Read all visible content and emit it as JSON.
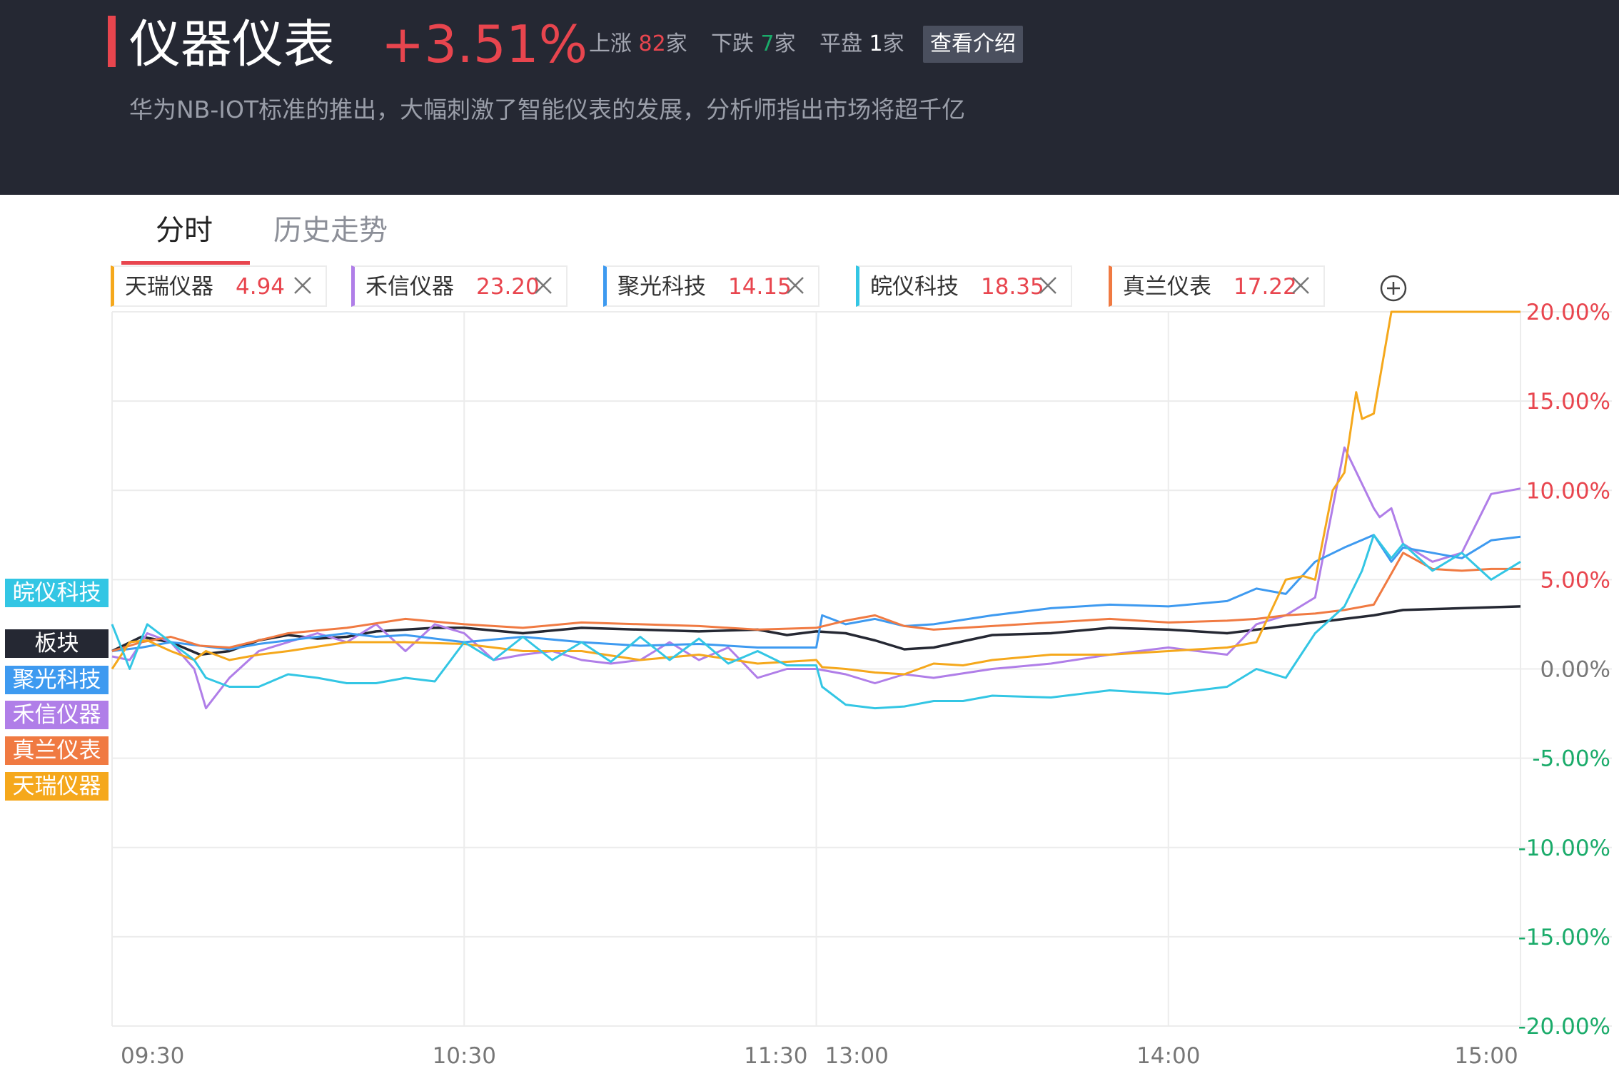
{
  "header": {
    "sector_name": "仪器仪表",
    "sector_change": "+3.51%",
    "up_label": "上涨",
    "up_count": "82",
    "down_label": "下跌",
    "down_count": "7",
    "flat_label": "平盘",
    "flat_count": "1",
    "unit": "家",
    "intro_button": "查看介绍",
    "subtitle": "华为NB-IOT标准的推出，大幅刺激了智能仪表的发展，分析师指出市场将超千亿"
  },
  "tabs": [
    {
      "label": "分时",
      "active": true
    },
    {
      "label": "历史走势",
      "active": false
    }
  ],
  "chips": [
    {
      "name": "天瑞仪器",
      "price": "4.94",
      "color": "#f5a81c"
    },
    {
      "name": "禾信仪器",
      "price": "23.20",
      "color": "#b07ee8"
    },
    {
      "name": "聚光科技",
      "price": "14.15",
      "color": "#3e9af0"
    },
    {
      "name": "皖仪科技",
      "price": "18.35",
      "color": "#33c6e4"
    },
    {
      "name": "真兰仪表",
      "price": "17.22",
      "color": "#f07a42"
    }
  ],
  "icons": {
    "close": "close-icon",
    "add": "plus-circle-icon"
  },
  "legend": [
    {
      "label": "皖仪科技",
      "color": "#33c6e4"
    },
    {
      "label": "板块",
      "color": "#252833"
    },
    {
      "label": "聚光科技",
      "color": "#3e9af0"
    },
    {
      "label": "禾信仪器",
      "color": "#b07ee8"
    },
    {
      "label": "真兰仪表",
      "color": "#f07a42"
    },
    {
      "label": "天瑞仪器",
      "color": "#f5a81c"
    }
  ],
  "colors": {
    "up": "#e8454e",
    "down": "#1aab6a",
    "header_bg": "#252833"
  },
  "chart_data": {
    "type": "line",
    "xlabel": "",
    "ylabel": "",
    "ylim": [
      -20,
      20
    ],
    "y_ticks": [
      20,
      15,
      10,
      5,
      0,
      -5,
      -10,
      -15,
      -20
    ],
    "y_tick_labels": [
      "20.00%",
      "15.00%",
      "10.00%",
      "5.00%",
      "0.00%",
      "-5.00%",
      "-10.00%",
      "-15.00%",
      "-20.00%"
    ],
    "x_ticks": [
      {
        "label": "09:30",
        "t": 0
      },
      {
        "label": "10:30",
        "t": 60
      },
      {
        "label": "11:30",
        "t": 120
      },
      {
        "label": "13:00",
        "t": 120
      },
      {
        "label": "14:00",
        "t": 180
      },
      {
        "label": "15:00",
        "t": 240
      }
    ],
    "grid": true,
    "legend_position": "left",
    "series": [
      {
        "name": "板块",
        "color": "#252833",
        "t": [
          0,
          5,
          10,
          15,
          20,
          25,
          30,
          35,
          40,
          45,
          50,
          55,
          60,
          70,
          80,
          90,
          100,
          110,
          115,
          120,
          125,
          130,
          135,
          140,
          150,
          160,
          170,
          180,
          190,
          200,
          210,
          215,
          220,
          230,
          240
        ],
        "values": [
          1,
          1.8,
          1.5,
          0.8,
          1,
          1.6,
          1.9,
          1.7,
          1.8,
          2.1,
          2.2,
          2.3,
          2.3,
          2,
          2.3,
          2.2,
          2.1,
          2.2,
          1.9,
          2.1,
          2,
          1.6,
          1.1,
          1.2,
          1.9,
          2,
          2.3,
          2.2,
          2,
          2.4,
          2.8,
          3,
          3.3,
          3.4,
          3.5
        ]
      },
      {
        "name": "禾信仪器",
        "color": "#b07ee8",
        "t": [
          0,
          3,
          6,
          10,
          14,
          16,
          20,
          25,
          30,
          35,
          40,
          45,
          50,
          55,
          60,
          65,
          70,
          75,
          80,
          85,
          90,
          95,
          100,
          105,
          110,
          115,
          120,
          125,
          130,
          135,
          140,
          150,
          160,
          170,
          180,
          190,
          195,
          200,
          205,
          210,
          215,
          216,
          218,
          220,
          225,
          230,
          235,
          240
        ],
        "values": [
          0.7,
          0.5,
          2,
          1.5,
          0,
          -2.2,
          -0.5,
          1,
          1.5,
          2,
          1.5,
          2.5,
          1,
          2.5,
          2,
          0.5,
          0.8,
          1,
          0.5,
          0.3,
          0.5,
          1.5,
          0.5,
          1.2,
          -0.5,
          0,
          0,
          -0.3,
          -0.8,
          -0.3,
          -0.5,
          0,
          0.3,
          0.8,
          1.2,
          0.8,
          2.5,
          3,
          4,
          12.4,
          9,
          8.5,
          9,
          7,
          6,
          6.5,
          9.8,
          10.1
        ]
      },
      {
        "name": "聚光科技",
        "color": "#3e9af0",
        "t": [
          0,
          5,
          10,
          15,
          20,
          25,
          30,
          35,
          40,
          45,
          50,
          60,
          70,
          80,
          90,
          100,
          110,
          120,
          121,
          125,
          130,
          135,
          140,
          150,
          160,
          170,
          180,
          190,
          195,
          200,
          205,
          210,
          215,
          218,
          220,
          225,
          230,
          235,
          240
        ],
        "values": [
          1,
          1.2,
          1.5,
          1.3,
          1.1,
          1.4,
          1.6,
          1.8,
          2,
          1.8,
          1.9,
          1.5,
          1.8,
          1.5,
          1.3,
          1.4,
          1.2,
          1.2,
          3,
          2.5,
          2.8,
          2.4,
          2.5,
          3,
          3.4,
          3.6,
          3.5,
          3.8,
          4.5,
          4.2,
          6,
          6.8,
          7.5,
          6,
          6.8,
          6.5,
          6.2,
          7.2,
          7.4
        ]
      },
      {
        "name": "真兰仪表",
        "color": "#f07a42",
        "t": [
          0,
          5,
          10,
          15,
          20,
          25,
          30,
          40,
          50,
          60,
          70,
          80,
          90,
          100,
          110,
          120,
          125,
          130,
          135,
          140,
          150,
          160,
          170,
          180,
          190,
          195,
          200,
          205,
          210,
          215,
          220,
          225,
          230,
          235,
          240
        ],
        "values": [
          1,
          1.5,
          1.8,
          1.3,
          1.2,
          1.6,
          2,
          2.3,
          2.8,
          2.5,
          2.3,
          2.6,
          2.5,
          2.4,
          2.2,
          2.3,
          2.7,
          3,
          2.4,
          2.2,
          2.4,
          2.6,
          2.8,
          2.6,
          2.7,
          2.8,
          3,
          3.1,
          3.3,
          3.6,
          6.5,
          5.6,
          5.5,
          5.6,
          5.6
        ]
      },
      {
        "name": "天瑞仪器",
        "color": "#f5a81c",
        "t": [
          0,
          3,
          6,
          10,
          14,
          16,
          20,
          25,
          30,
          40,
          50,
          60,
          70,
          80,
          90,
          100,
          110,
          120,
          121,
          125,
          130,
          135,
          140,
          145,
          150,
          160,
          170,
          180,
          190,
          195,
          200,
          203,
          205,
          208,
          210,
          212,
          213,
          215,
          218,
          220,
          225,
          230,
          240
        ],
        "values": [
          0,
          1.5,
          1.6,
          1,
          0.5,
          1,
          0.5,
          0.8,
          1,
          1.5,
          1.5,
          1.4,
          1,
          1,
          0.5,
          0.8,
          0.3,
          0.5,
          0.1,
          0,
          -0.2,
          -0.3,
          0.3,
          0.2,
          0.5,
          0.8,
          0.8,
          1,
          1.2,
          1.5,
          5,
          5.2,
          5,
          10,
          11,
          15.5,
          14,
          14.3,
          20,
          20,
          20,
          20,
          20
        ]
      },
      {
        "name": "皖仪科技",
        "color": "#33c6e4",
        "t": [
          0,
          3,
          6,
          10,
          14,
          16,
          20,
          25,
          30,
          35,
          40,
          45,
          50,
          55,
          60,
          65,
          70,
          75,
          80,
          85,
          90,
          95,
          100,
          105,
          110,
          115,
          120,
          121,
          125,
          130,
          135,
          140,
          145,
          150,
          160,
          170,
          180,
          190,
          195,
          200,
          205,
          210,
          213,
          215,
          218,
          220,
          225,
          230,
          235,
          240
        ],
        "values": [
          2.5,
          0,
          2.5,
          1.5,
          0.5,
          -0.5,
          -1,
          -1,
          -0.3,
          -0.5,
          -0.8,
          -0.8,
          -0.5,
          -0.7,
          1.5,
          0.5,
          1.8,
          0.5,
          1.5,
          0.4,
          1.8,
          0.5,
          1.7,
          0.3,
          1,
          0.2,
          0.2,
          -1,
          -2,
          -2.2,
          -2.1,
          -1.8,
          -1.8,
          -1.5,
          -1.6,
          -1.2,
          -1.4,
          -1,
          0,
          -0.5,
          2,
          3.5,
          5.5,
          7.5,
          6.2,
          7,
          5.5,
          6.5,
          5,
          6
        ]
      }
    ]
  }
}
